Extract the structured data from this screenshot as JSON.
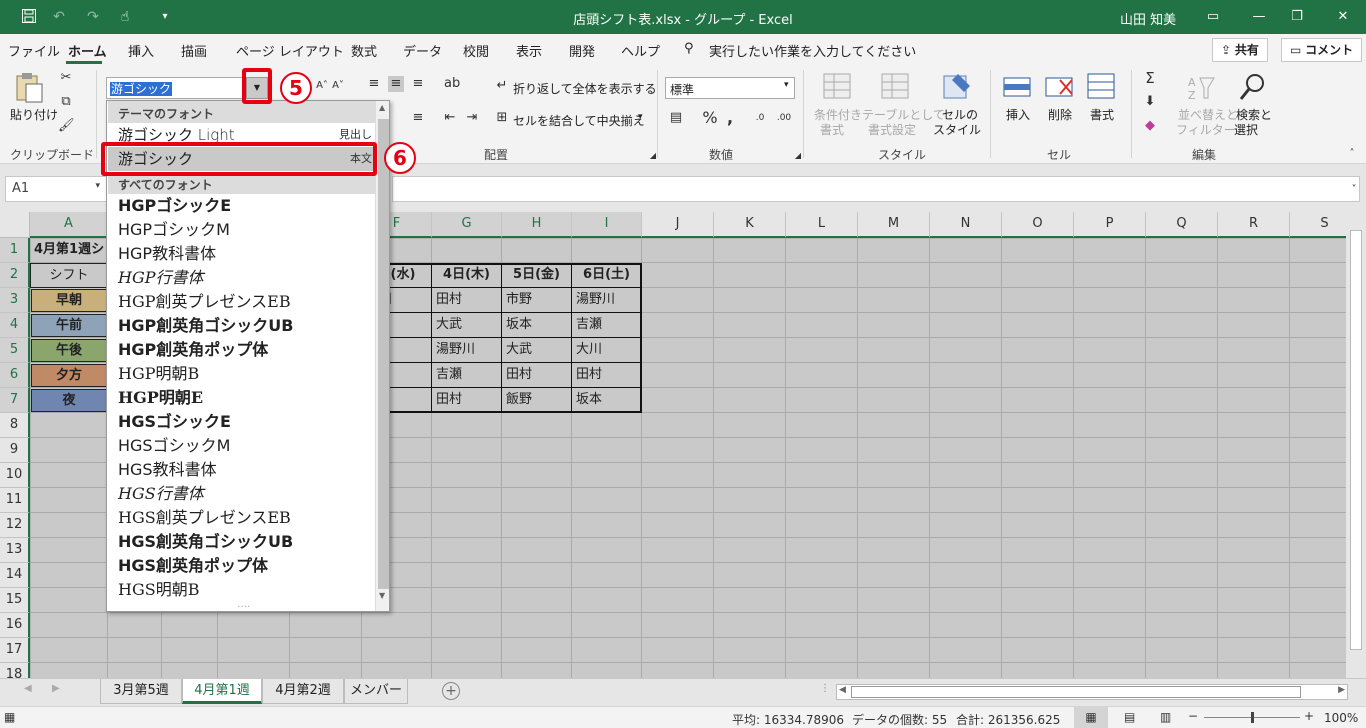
{
  "titlebar": {
    "title": "店頭シフト表.xlsx  -  グループ  -  Excel",
    "user": "山田 知美"
  },
  "menu": {
    "tabs": [
      "ファイル",
      "ホーム",
      "挿入",
      "描画",
      "ページ レイアウト",
      "数式",
      "データ",
      "校閲",
      "表示",
      "開発",
      "ヘルプ"
    ],
    "active_tab": "ホーム",
    "tellme": "実行したい作業を入力してください",
    "share": "共有",
    "comment": "コメント"
  },
  "ribbon": {
    "paste": "貼り付け",
    "clipboard": "クリップボード",
    "font_name": "游ゴシック",
    "wrap_text": "折り返して全体を表示する",
    "merge_center": "セルを結合して中央揃え",
    "alignment": "配置",
    "number_format": "標準",
    "number": "数値",
    "cond_format_1": "条件付き",
    "cond_format_2": "書式",
    "table_format_1": "テーブルとして",
    "table_format_2": "書式設定",
    "cell_style_1": "セルの",
    "cell_style_2": "スタイル",
    "styles": "スタイル",
    "insert": "挿入",
    "delete": "削除",
    "format": "書式",
    "cells": "セル",
    "sort_1": "並べ替えと",
    "sort_2": "フィルター",
    "find_1": "検索と",
    "find_2": "選択",
    "editing": "編集"
  },
  "callouts": {
    "c5": "5",
    "c6": "6"
  },
  "formula_bar": {
    "name_box": "A1",
    "formula": ""
  },
  "sheet": {
    "columns": [
      "A",
      "B",
      "C",
      "D",
      "E",
      "F",
      "G",
      "H",
      "I",
      "J",
      "K",
      "L",
      "M",
      "N",
      "O",
      "P",
      "Q",
      "R",
      "S"
    ],
    "rows": [
      "1",
      "2",
      "3",
      "4",
      "5",
      "6",
      "7",
      "8",
      "9",
      "10",
      "11",
      "12",
      "13",
      "14",
      "15",
      "16",
      "17",
      "18"
    ],
    "a1": "4月第1週シ",
    "a2": "シフト",
    "shifts": [
      "早朝",
      "午前",
      "午後",
      "夕方",
      "夜"
    ],
    "headers": [
      "日(水)",
      "4日(木)",
      "5日(金)",
      "6日(土)"
    ],
    "grid": [
      [
        "野川",
        "田村",
        "市野",
        "湯野川"
      ],
      [
        "瀬",
        "大武",
        "坂本",
        "吉瀬"
      ],
      [
        "野",
        "湯野川",
        "大武",
        "大川"
      ],
      [
        "村",
        "吉瀬",
        "田村",
        "田村"
      ],
      [
        "野",
        "田村",
        "飯野",
        "坂本"
      ]
    ]
  },
  "font_dropdown": {
    "theme_header": "テーマのフォント",
    "theme_fonts": [
      {
        "name": "游ゴシック Light",
        "tag": "見出し"
      },
      {
        "name": "游ゴシック",
        "tag": "本文"
      }
    ],
    "all_header": "すべてのフォント",
    "fonts": [
      "HGPゴシックE",
      "HGPゴシックM",
      "HGP教科書体",
      "HGP行書体",
      "HGP創英プレゼンスEB",
      "HGP創英角ゴシックUB",
      "HGP創英角ポップ体",
      "HGP明朝B",
      "HGP明朝E",
      "HGSゴシックE",
      "HGSゴシックM",
      "HGS教科書体",
      "HGS行書体",
      "HGS創英プレゼンスEB",
      "HGS創英角ゴシックUB",
      "HGS創英角ポップ体",
      "HGS明朝B"
    ]
  },
  "sheet_tabs": [
    "3月第5週",
    "4月第1週",
    "4月第2週",
    "メンバー"
  ],
  "active_sheet": "4月第1週",
  "status": {
    "average": "平均: 16334.78906",
    "count": "データの個数: 55",
    "sum": "合計: 261356.625",
    "zoom": "100%"
  },
  "colors": {
    "excel_green": "#217346",
    "callout_red": "#e60012",
    "early": "#c9b07a",
    "morning": "#8ea3b8",
    "afternoon": "#8aa66c",
    "evening": "#c08a66",
    "night": "#6f86b0"
  }
}
